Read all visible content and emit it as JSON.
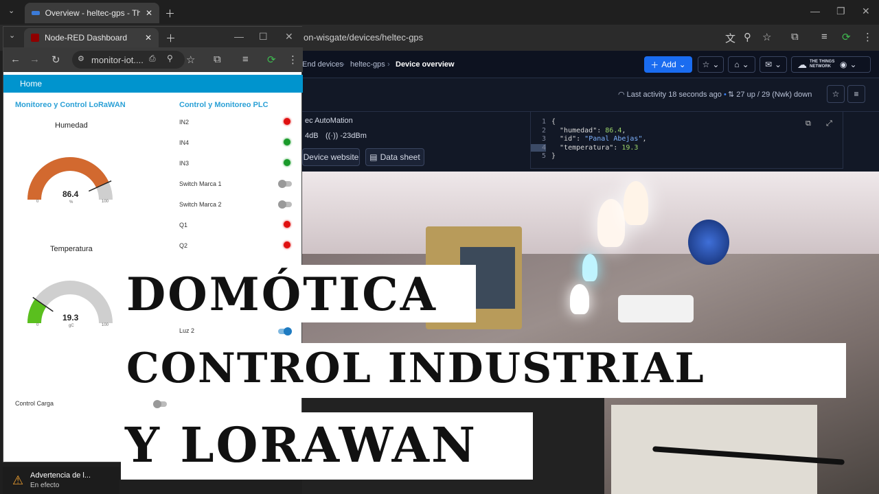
{
  "back_browser": {
    "tab_title": "Overview - heltec-gps - The Thi",
    "url": "on-wisgate/devices/heltec-gps"
  },
  "ttn": {
    "breadcrumbs": [
      "End devices",
      "heltec-gps",
      "Device overview"
    ],
    "add_label": "Add",
    "brand": "THE THINGS NETWORK",
    "last_activity": "Last activity 18 seconds ago",
    "traffic": "27 up / 29 (Nwk) down",
    "vendor": "ec AutoMation",
    "snr": "4dB",
    "rssi": "-23dBm",
    "device_website": "Device website",
    "data_sheet": "Data sheet",
    "code_lines": [
      {
        "n": "1",
        "t": "{"
      },
      {
        "n": "2",
        "k": "\"humedad\": ",
        "v": "86.4",
        "s": ","
      },
      {
        "n": "3",
        "k": "\"id\": ",
        "v": "\"Panal Abejas\"",
        "s": ","
      },
      {
        "n": "4",
        "k": "\"temperatura\": ",
        "v": "19.3",
        "s": ""
      },
      {
        "n": "5",
        "t": "}"
      }
    ]
  },
  "nodered": {
    "tab_title": "Node-RED Dashboard",
    "url": "monitor-iot....",
    "nav_home": "Home",
    "group_left": "Monitoreo y Control LoRaWAN",
    "group_right": "Control y Monitoreo PLC",
    "gauge_humidity": {
      "label": "Humedad",
      "value": "86.4",
      "unit": "%",
      "min": "0",
      "max": "100",
      "fraction": 0.864,
      "color": "#d2692f"
    },
    "gauge_temp": {
      "label": "Temperatura",
      "value": "19.3",
      "unit": "gC",
      "min": "0",
      "max": "100",
      "fraction": 0.193,
      "color": "#5abf1e"
    },
    "control_carga": "Control Carga",
    "plc_items": [
      {
        "label": "IN2",
        "kind": "led",
        "color": "#e01010"
      },
      {
        "label": "IN4",
        "kind": "led",
        "color": "#1a9a2a"
      },
      {
        "label": "IN3",
        "kind": "led",
        "color": "#1a9a2a"
      },
      {
        "label": "Switch Marca 1",
        "kind": "switch",
        "on": false
      },
      {
        "label": "Switch Marca 2",
        "kind": "switch",
        "on": false
      },
      {
        "label": "Q1",
        "kind": "led",
        "color": "#e01010"
      },
      {
        "label": "Q2",
        "kind": "led",
        "color": "#e01010"
      }
    ],
    "luz2": "Luz 2"
  },
  "banners": {
    "line1": "DOMÓTICA",
    "line2": "CONTROL INDUSTRIAL",
    "line3": "Y LORAWAN"
  },
  "notification": {
    "title": "Advertencia de l...",
    "subtitle": "En efecto"
  }
}
